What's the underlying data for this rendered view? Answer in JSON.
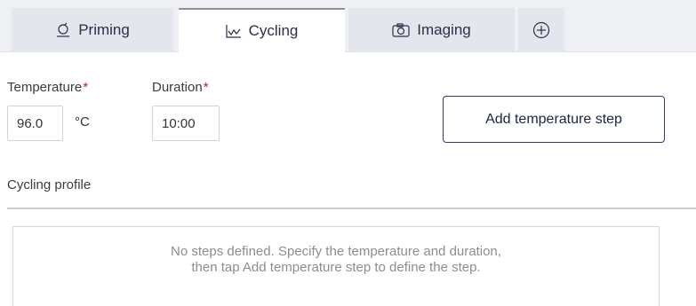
{
  "tabs": [
    {
      "label": "Priming",
      "icon": "priming-icon",
      "active": false
    },
    {
      "label": "Cycling",
      "icon": "cycling-chart-icon",
      "active": true
    },
    {
      "label": "Imaging",
      "icon": "camera-icon",
      "active": false
    }
  ],
  "add_tab_icon": "plus-circle-icon",
  "form": {
    "temperature": {
      "label": "Temperature",
      "required_mark": "*",
      "value": "96.0",
      "unit": "°C"
    },
    "duration": {
      "label": "Duration",
      "required_mark": "*",
      "value": "10:00"
    },
    "add_button_label": "Add temperature step"
  },
  "profile": {
    "title": "Cycling profile",
    "empty_line1": "No steps defined. Specify the temperature and duration,",
    "empty_line2": "then tap Add temperature step to define the step."
  },
  "colors": {
    "required": "#c0192f",
    "button_border": "#2b3a6b",
    "tab_active": "#ffffff",
    "tab_inactive": "#e3e6ed"
  }
}
